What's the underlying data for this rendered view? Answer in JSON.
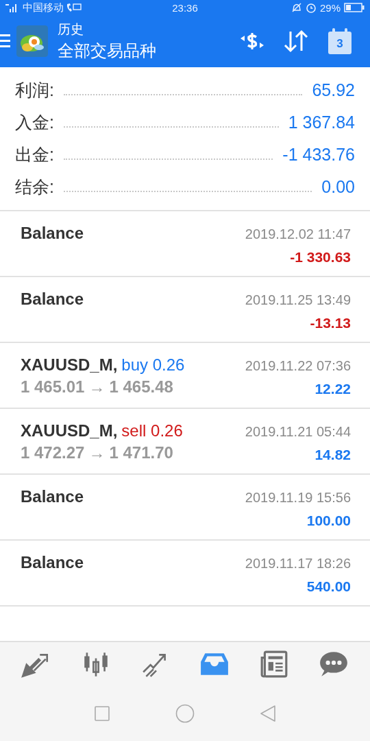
{
  "status_bar": {
    "carrier": "中国移动",
    "time": "23:36",
    "battery": "29%"
  },
  "app_bar": {
    "title": "历史",
    "subtitle": "全部交易品种",
    "calendar_day": "3"
  },
  "summary": [
    {
      "label": "利润:",
      "value": "65.92"
    },
    {
      "label": "入金:",
      "value": "1 367.84"
    },
    {
      "label": "出金:",
      "value": "-1 433.76"
    },
    {
      "label": "结余:",
      "value": "0.00"
    }
  ],
  "deals": [
    {
      "kind": "balance",
      "title": "Balance",
      "time": "2019.12.02 11:47",
      "amount": "-1 330.63",
      "loss": true
    },
    {
      "kind": "balance",
      "title": "Balance",
      "time": "2019.11.25 13:49",
      "amount": "-13.13",
      "loss": true
    },
    {
      "kind": "trade",
      "symbol": "XAUUSD_M,",
      "side": "buy",
      "short": false,
      "volume": "0.26",
      "open_price": "1 465.01",
      "arrow": "→",
      "close_price": "1 465.48",
      "time": "2019.11.22 07:36",
      "amount": "12.22",
      "loss": false
    },
    {
      "kind": "trade",
      "symbol": "XAUUSD_M,",
      "side": "sell",
      "short": true,
      "volume": "0.26",
      "open_price": "1 472.27",
      "arrow": "→",
      "close_price": "1 471.70",
      "time": "2019.11.21 05:44",
      "amount": "14.82",
      "loss": false
    },
    {
      "kind": "balance",
      "title": "Balance",
      "time": "2019.11.19 15:56",
      "amount": "100.00",
      "loss": false
    },
    {
      "kind": "balance",
      "title": "Balance",
      "time": "2019.11.17 18:26",
      "amount": "540.00",
      "loss": false
    }
  ],
  "bottom_nav": [
    {
      "selected": false
    },
    {
      "selected": false
    },
    {
      "selected": false
    },
    {
      "selected": true
    },
    {
      "selected": false
    },
    {
      "selected": false
    }
  ]
}
